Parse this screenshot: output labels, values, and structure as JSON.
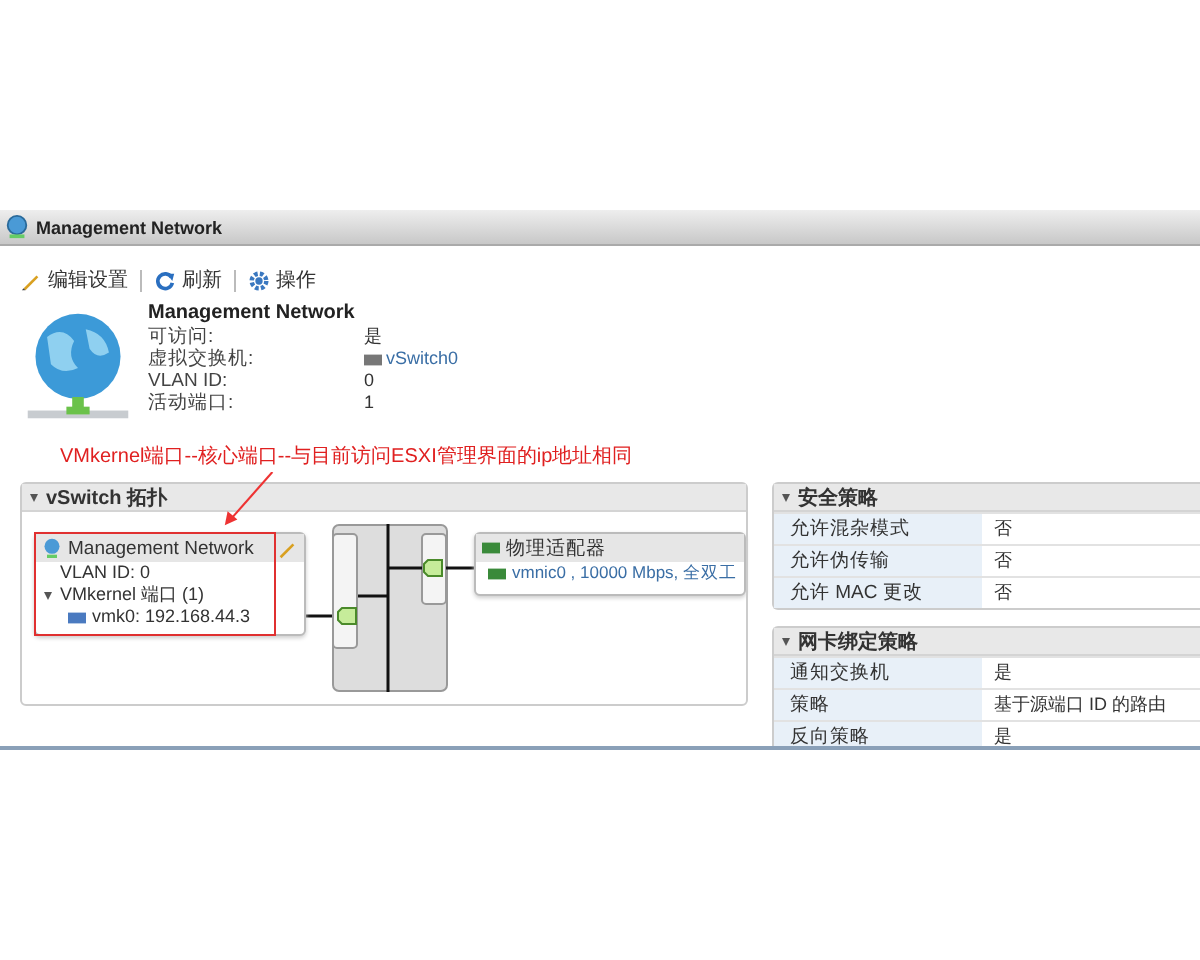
{
  "window": {
    "title": "Management Network"
  },
  "toolbar": [
    {
      "label": "编辑设置",
      "kind": "edit"
    },
    {
      "label": "刷新",
      "kind": "refresh"
    },
    {
      "label": "操作",
      "kind": "actions"
    }
  ],
  "summary": {
    "name": "Management Network",
    "fields": [
      {
        "label": "可访问:",
        "value": "是",
        "kind": "text"
      },
      {
        "label": "虚拟交换机:",
        "value": "vSwitch0",
        "kind": "link"
      },
      {
        "label": "VLAN ID:",
        "value": "0",
        "kind": "text"
      },
      {
        "label": "活动端口:",
        "value": "1",
        "kind": "text"
      }
    ]
  },
  "annotation": "VMkernel端口--核心端口--与目前访问ESXI管理界面的ip地址相同",
  "topology": {
    "title": "vSwitch 拓扑",
    "expanded": true,
    "portgroup": {
      "name": "Management Network",
      "vlan": "VLAN ID: 0",
      "group": {
        "label": "VMkernel 端口 (1)",
        "expanded": true,
        "children": [
          {
            "label": "vmk0: 192.168.44.3"
          }
        ]
      }
    },
    "adapters": {
      "title": "物理适配器",
      "items": [
        "vmnic0 , 10000 Mbps, 全双工"
      ]
    }
  },
  "policies": [
    {
      "title": "安全策略",
      "expanded": true,
      "rows": [
        {
          "label": "允许混杂模式",
          "value": "否"
        },
        {
          "label": "允许伪传输",
          "value": "否"
        },
        {
          "label": "允许 MAC 更改",
          "value": "否"
        }
      ]
    },
    {
      "title": "网卡绑定策略",
      "expanded": true,
      "rows": [
        {
          "label": "通知交换机",
          "value": "是"
        },
        {
          "label": "策略",
          "value": "基于源端口 ID 的路由"
        },
        {
          "label": "反向策略",
          "value": "是"
        }
      ]
    }
  ]
}
